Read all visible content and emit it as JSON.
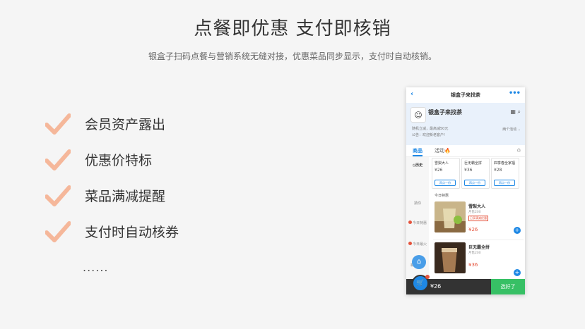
{
  "title": "点餐即优惠  支付即核销",
  "subtitle": "银盒子扫码点餐与营销系统无缝对接，优惠菜品同步显示，支付时自动核销。",
  "features": [
    {
      "label": "会员资产露出"
    },
    {
      "label": "优惠价特标"
    },
    {
      "label": "菜品满减提醒"
    },
    {
      "label": "支付时自动核券"
    }
  ],
  "ellipsis": "......",
  "colors": {
    "check": "#f5b79a",
    "accent": "#1e88e5",
    "price": "#e5533c",
    "checkout": "#37c065"
  },
  "phone": {
    "nav_title": "银盒子来找茶",
    "shop_name": "银盒子来找茶",
    "info_line1": "随机立减，最高减50元",
    "info_line2": "公告：欢迎新老客户!",
    "activity": "两个活动 ⌄",
    "tabs": [
      {
        "label": "商品"
      },
      {
        "label": "活动🔥"
      }
    ],
    "sidebar": [
      {
        "label": "历史"
      },
      {
        "label": "猜你"
      },
      {
        "label": "今日特惠"
      },
      {
        "label": "今日最火"
      },
      {
        "label": "新品草莓"
      }
    ],
    "recommend": [
      {
        "name": "雪梨大人",
        "price": "¥26",
        "btn": "再点一份"
      },
      {
        "name": "巨无霸全拼",
        "price": "¥36",
        "btn": "再点一份"
      },
      {
        "name": "四季春全家福",
        "price": "¥28",
        "btn": "再点一份"
      }
    ],
    "section_label": "今日特惠",
    "items": [
      {
        "name": "雪梨大人",
        "sold": "月售200",
        "tag": "已享满减优惠",
        "price": "¥26"
      },
      {
        "name": "巨无霸全拼",
        "sold": "月售200",
        "tag": "",
        "price": "¥36"
      }
    ],
    "total": "¥26",
    "checkout": "选好了"
  }
}
